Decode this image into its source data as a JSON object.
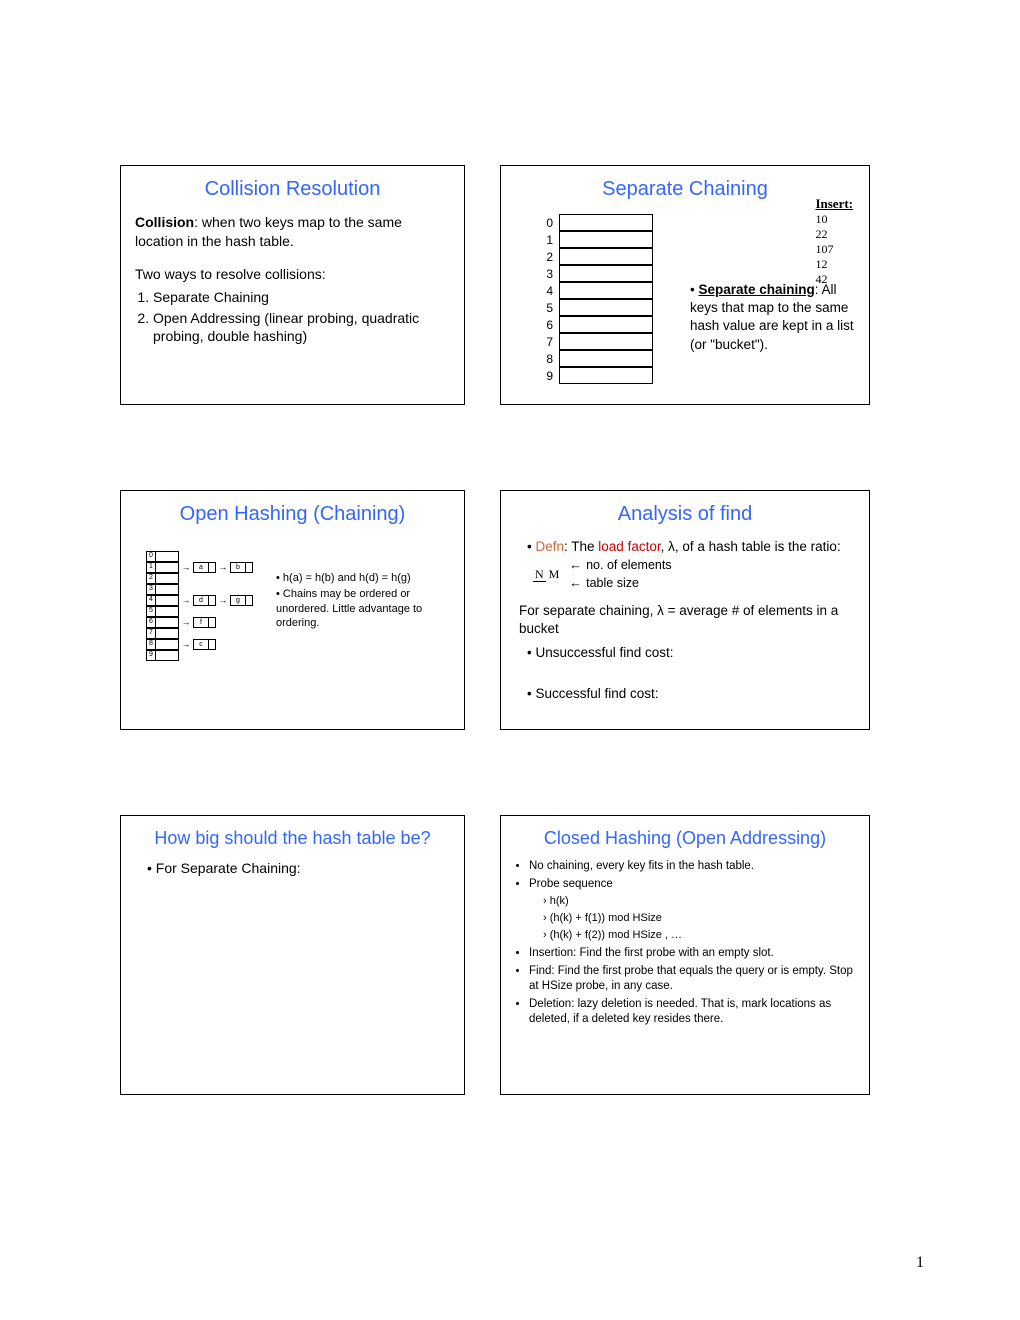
{
  "pageNumber": "1",
  "slide1": {
    "title": "Collision Resolution",
    "p1a": "Collision",
    "p1b": ": when two keys map to the same location in the hash table.",
    "p2": "Two ways to resolve collisions:",
    "li1": "Separate Chaining",
    "li2": "Open Addressing (linear probing, quadratic probing, double hashing)"
  },
  "slide2": {
    "title": "Separate Chaining",
    "indices": [
      "0",
      "1",
      "2",
      "3",
      "4",
      "5",
      "6",
      "7",
      "8",
      "9"
    ],
    "insertLabel": "Insert:",
    "insertVals": [
      "10",
      "22",
      "107",
      "12",
      "42"
    ],
    "lead": "Separate chaining",
    "text": ": All keys that map to the same hash value are kept in a list (or \"bucket\")."
  },
  "slide3": {
    "title": "Open Hashing (Chaining)",
    "indices": [
      "0",
      "1",
      "2",
      "3",
      "4",
      "5",
      "6",
      "7",
      "8",
      "9"
    ],
    "chains": {
      "1": [
        "a",
        "b"
      ],
      "4": [
        "d",
        "g"
      ],
      "6": [
        "f"
      ],
      "8": [
        "c"
      ]
    },
    "note1": "h(a) = h(b) and h(d) = h(g)",
    "note2": "Chains may be ordered or unordered.  Little advantage to ordering."
  },
  "slide4": {
    "title": "Analysis of find",
    "defnWord": "Defn",
    "defnA": ": The ",
    "load": "load factor",
    "defnB": ", λ, of a hash table is the ratio:",
    "fracN": "N",
    "fracM": "M",
    "numLabel": "no. of elements",
    "denLabel": "table size",
    "p2": "For separate chaining, λ = average # of elements in a bucket",
    "b1": "Unsuccessful find cost:",
    "b2": "Successful find cost:"
  },
  "slide5": {
    "title": "How big should the hash table be?",
    "b1": "For Separate Chaining:"
  },
  "slide6": {
    "title": "Closed Hashing (Open Addressing)",
    "b1": "No chaining, every key fits in the hash table.",
    "b2": "Probe sequence",
    "s1": "h(k)",
    "s2": "(h(k) + f(1)) mod HSize",
    "s3": "(h(k) + f(2)) mod HSize , …",
    "b3": "Insertion: Find the first probe with an empty slot.",
    "b4": "Find:  Find the first probe that equals the query or is empty.  Stop at HSize probe, in any case.",
    "b5": "Deletion: lazy deletion is needed.  That is, mark locations as deleted, if a deleted key resides there."
  }
}
